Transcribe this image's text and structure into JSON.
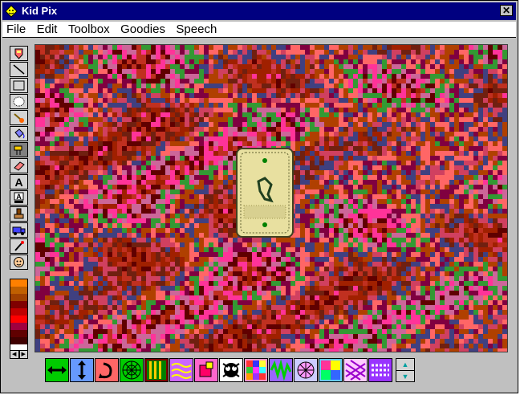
{
  "window": {
    "title": "Kid Pix",
    "close_glyph": "✕"
  },
  "menu": {
    "items": [
      "File",
      "Edit",
      "Toolbox",
      "Goodies",
      "Speech"
    ]
  },
  "tools": [
    {
      "name": "wacky-pencil-tool-icon"
    },
    {
      "name": "line-tool-icon"
    },
    {
      "name": "rectangle-tool-icon"
    },
    {
      "name": "oval-tool-icon"
    },
    {
      "name": "paint-brush-tool-icon"
    },
    {
      "name": "paint-bucket-tool-icon"
    },
    {
      "name": "electric-mixer-tool-icon",
      "selected": true
    },
    {
      "name": "eraser-tool-icon"
    },
    {
      "name": "text-tool-icon"
    },
    {
      "name": "moving-van-text-tool-icon"
    },
    {
      "name": "rubber-stamp-tool-icon"
    },
    {
      "name": "moving-van-tool-icon"
    },
    {
      "name": "eyedropper-tool-icon"
    },
    {
      "name": "undo-guy-icon"
    }
  ],
  "palette_colors": [
    "#ff8000",
    "#c06000",
    "#a04000",
    "#800000",
    "#c00000",
    "#ff0000",
    "#a00040",
    "#600000",
    "#400000"
  ],
  "palette_arrows": {
    "left": "◀",
    "right": "▶"
  },
  "mixer_options": [
    {
      "name": "flip-horizontal-option",
      "bg": "#00cc00"
    },
    {
      "name": "flip-vertical-option",
      "bg": "#6699ff"
    },
    {
      "name": "rotate-option",
      "bg": "#ff6666"
    },
    {
      "name": "spider-web-option",
      "bg": "#00cc00"
    },
    {
      "name": "stripes-option",
      "bg": "#008000",
      "selected": true
    },
    {
      "name": "wavy-lines-option",
      "bg": "#cc66ff"
    },
    {
      "name": "magnify-option",
      "bg": "#ff66cc"
    },
    {
      "name": "black-and-white-option",
      "bg": "#ffffff"
    },
    {
      "name": "mosaic-option",
      "bg": "#ff99cc"
    },
    {
      "name": "scramble-option",
      "bg": "#9966ff"
    },
    {
      "name": "pattern-option",
      "bg": "#ccccff"
    },
    {
      "name": "tile-option",
      "bg": "#66ccff"
    },
    {
      "name": "weave-option",
      "bg": "#ffccff"
    },
    {
      "name": "dotted-lines-option",
      "bg": "#9933ff"
    }
  ],
  "scroll_arrows": {
    "up": "▲",
    "down": "▼"
  },
  "accent": {
    "titlebar": "#000080",
    "chrome": "#c0c0c0"
  }
}
